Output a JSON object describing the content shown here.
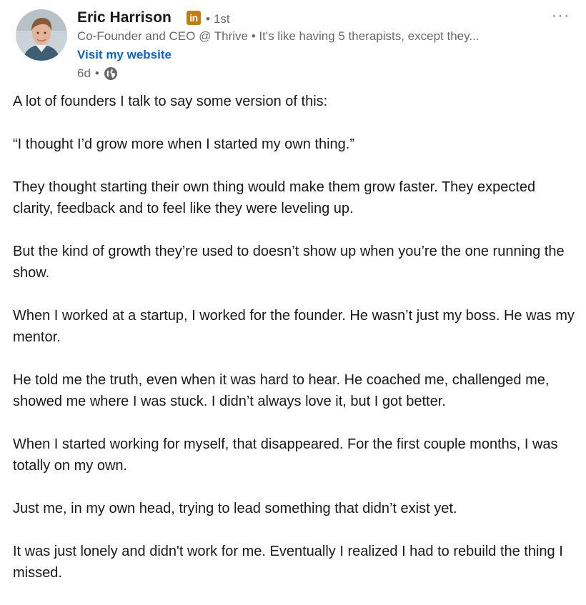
{
  "author": {
    "name": "Eric Harrison",
    "badge": "in",
    "degree_separator": "•",
    "degree": "1st",
    "headline": "Co-Founder and CEO @ Thrive • It's like having 5 therapists, except they...",
    "website_label": "Visit my website"
  },
  "meta": {
    "time": "6d",
    "separator": "•",
    "visibility_icon": "globe-icon"
  },
  "menu": {
    "more_label": "···"
  },
  "post": {
    "paragraphs": [
      "A lot of founders I talk to say some version of this:",
      "“I thought I’d grow more when I started my own thing.”",
      "They thought starting their own thing would make them grow faster. They expected clarity, feedback and to feel like they were leveling up.",
      "But the kind of growth they’re used to doesn’t show up when you’re the one running the show.",
      "When I worked at a startup, I worked for the founder. He wasn’t just my boss. He was my mentor.",
      "He told me the truth, even when it was hard to hear. He coached me, challenged me, showed me where I was stuck. I didn’t always love it, but I got better.",
      "When I started working for myself, that disappeared. For the first couple months, I was totally on my own.",
      "Just me, in my own head, trying to lead something that didn’t exist yet.",
      "It was just lonely and didn't work for me. Eventually I realized I had to rebuild the thing I missed."
    ]
  },
  "colors": {
    "link": "#0a66c2",
    "badge": "#c37d16",
    "secondary_text": "#666666"
  }
}
